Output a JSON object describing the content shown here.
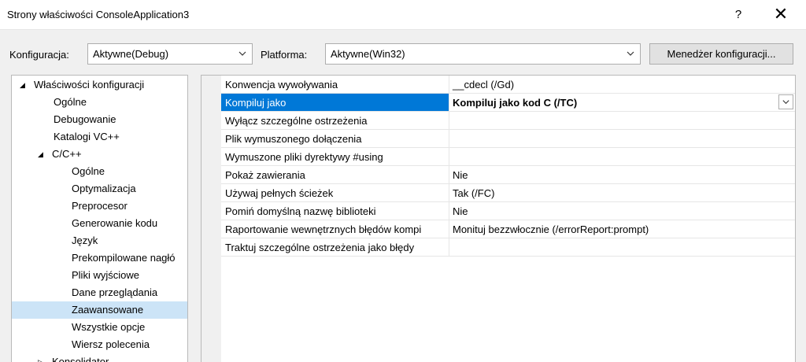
{
  "window": {
    "title": "Strony właściwości ConsoleApplication3",
    "help": "?",
    "close": "✕"
  },
  "toolbar": {
    "config_label": "Konfiguracja:",
    "config_value": "Aktywne(Debug)",
    "platform_label": "Platforma:",
    "platform_value": "Aktywne(Win32)",
    "manager_button": "Menedżer konfiguracji..."
  },
  "tree": {
    "items": [
      {
        "label": "Właściwości konfiguracji",
        "glyph": "◢"
      },
      {
        "label": "Ogólne"
      },
      {
        "label": "Debugowanie"
      },
      {
        "label": "Katalogi VC++"
      },
      {
        "label": "C/C++",
        "glyph": "◢"
      },
      {
        "label": "Ogólne"
      },
      {
        "label": "Optymalizacja"
      },
      {
        "label": "Preprocesor"
      },
      {
        "label": "Generowanie kodu"
      },
      {
        "label": "Język"
      },
      {
        "label": "Prekompilowane nagłó"
      },
      {
        "label": "Pliki wyjściowe"
      },
      {
        "label": "Dane przeglądania"
      },
      {
        "label": "Zaawansowane"
      },
      {
        "label": "Wszystkie opcje"
      },
      {
        "label": "Wiersz polecenia"
      },
      {
        "label": "Konsolidator",
        "glyph": "▷"
      }
    ]
  },
  "properties": {
    "rows": [
      {
        "name": "Konwencja wywoływania",
        "value": "__cdecl (/Gd)"
      },
      {
        "name": "Kompiluj jako",
        "value": "Kompiluj jako kod C (/TC)"
      },
      {
        "name": "Wyłącz szczególne ostrzeżenia",
        "value": ""
      },
      {
        "name": "Plik wymuszonego dołączenia",
        "value": ""
      },
      {
        "name": "Wymuszone pliki dyrektywy #using",
        "value": ""
      },
      {
        "name": "Pokaż zawierania",
        "value": "Nie"
      },
      {
        "name": "Używaj pełnych ścieżek",
        "value": "Tak (/FC)"
      },
      {
        "name": "Pomiń domyślną nazwę biblioteki",
        "value": "Nie"
      },
      {
        "name": "Raportowanie wewnętrznych błędów kompi",
        "value": "Monituj bezzwłocznie (/errorReport:prompt)"
      },
      {
        "name": "Traktuj szczególne ostrzeżenia jako błędy",
        "value": ""
      }
    ]
  },
  "colors": {
    "selection": "#0078d7",
    "tree_selection": "#cce4f7"
  }
}
